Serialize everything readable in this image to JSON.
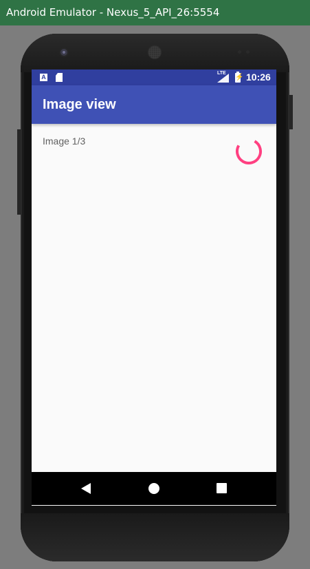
{
  "window": {
    "title": "Android Emulator - Nexus_5_API_26:5554"
  },
  "statusbar": {
    "left_icons": [
      "keyboard-a-icon",
      "sd-card-icon"
    ],
    "network_label": "LTE",
    "time": "10:26",
    "battery_glyph": "⚡"
  },
  "appbar": {
    "title": "Image view"
  },
  "content": {
    "image_label": "Image 1/3",
    "loading": true
  },
  "navbar": {
    "buttons": [
      "back",
      "home",
      "recents"
    ]
  },
  "colors": {
    "titlebar": "#2f7345",
    "statusbar": "#303f9f",
    "appbar": "#3f51b5",
    "spinner": "#ff4081",
    "screen": "#fafafa"
  }
}
